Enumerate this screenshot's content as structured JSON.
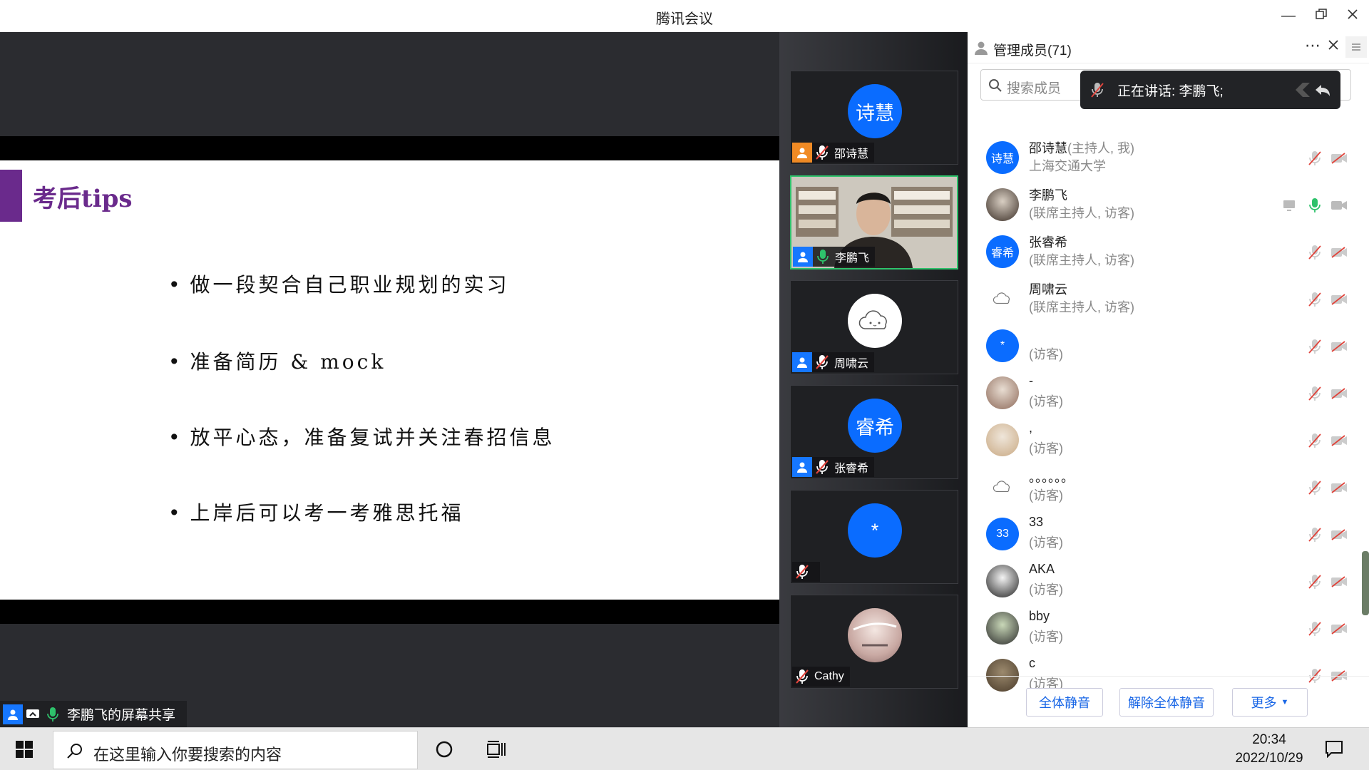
{
  "window": {
    "title": "腾讯会议"
  },
  "slide": {
    "title": "考后tips",
    "bullets": [
      "做一段契合自己职业规划的实习",
      "准备简历 & mock",
      "放平心态，准备复试并关注春招信息",
      "上岸后可以考一考雅思托福"
    ]
  },
  "share_label": "李鹏飞的屏幕共享",
  "video_tiles": [
    {
      "avatar_text": "诗慧",
      "name": "邵诗慧",
      "mic": "muted"
    },
    {
      "avatar_text": "",
      "name": "李鹏飞",
      "mic": "on",
      "speaking": true
    },
    {
      "avatar_text": "",
      "name": "周啸云",
      "mic": "muted"
    },
    {
      "avatar_text": "睿希",
      "name": "张睿希",
      "mic": "muted"
    },
    {
      "avatar_text": "*",
      "name": "",
      "mic": "muted"
    },
    {
      "avatar_text": "",
      "name": "Cathy",
      "mic": "muted"
    }
  ],
  "panel": {
    "title": "管理成员(71)",
    "search_placeholder": "搜索成员",
    "speaking_toast": "正在讲话: 李鹏飞;",
    "members": [
      {
        "avatar_text": "诗慧",
        "name": "邵诗慧",
        "role": "(主持人, 我)",
        "sub": "上海交通大学"
      },
      {
        "avatar_text": "",
        "name": "李鹏飞",
        "role": "",
        "sub": "(联席主持人, 访客)"
      },
      {
        "avatar_text": "睿希",
        "name": "张睿希",
        "role": "",
        "sub": "(联席主持人, 访客)"
      },
      {
        "avatar_text": "",
        "name": "周啸云",
        "role": "",
        "sub": "(联席主持人, 访客)"
      },
      {
        "avatar_text": "*",
        "name": "",
        "role": "",
        "sub": "(访客)"
      },
      {
        "avatar_text": "",
        "name": "-",
        "role": "",
        "sub": "(访客)"
      },
      {
        "avatar_text": "",
        "name": ",",
        "role": "",
        "sub": "(访客)"
      },
      {
        "avatar_text": "",
        "name": "。。。。。。",
        "role": "",
        "sub": "(访客)"
      },
      {
        "avatar_text": "33",
        "name": "33",
        "role": "",
        "sub": "(访客)"
      },
      {
        "avatar_text": "",
        "name": "AKA",
        "role": "",
        "sub": "(访客)"
      },
      {
        "avatar_text": "",
        "name": "bby",
        "role": "",
        "sub": "(访客)"
      },
      {
        "avatar_text": "",
        "name": "c",
        "role": "",
        "sub": "(访客)"
      }
    ],
    "buttons": {
      "mute_all": "全体静音",
      "unmute_all": "解除全体静音",
      "more": "更多"
    }
  },
  "taskbar": {
    "search_placeholder": "在这里输入你要搜索的内容",
    "time": "20:34",
    "date": "2022/10/29"
  },
  "colors": {
    "accent_blue": "#0a6cff",
    "slide_purple": "#6a2a8c",
    "speaking_green": "#2ec26b",
    "muted_red": "#e0443c"
  }
}
